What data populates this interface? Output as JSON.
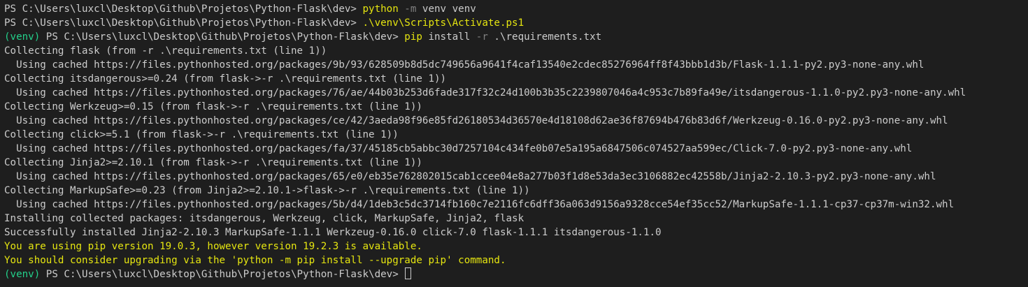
{
  "colors": {
    "background": "#1e1e1e",
    "default_text": "#cccccc",
    "command": "#e5e510",
    "parameter": "#808080",
    "venv": "#23d18b",
    "warning": "#e5e510"
  },
  "terminal": {
    "lines": [
      [
        {
          "text": "PS C:\\Users\\luxcl\\Desktop\\Github\\Projetos\\Python-Flask\\dev> ",
          "style": "default"
        },
        {
          "text": "python",
          "style": "yellow"
        },
        {
          "text": " -m",
          "style": "gray"
        },
        {
          "text": " venv venv",
          "style": "default"
        }
      ],
      [
        {
          "text": "PS C:\\Users\\luxcl\\Desktop\\Github\\Projetos\\Python-Flask\\dev> ",
          "style": "default"
        },
        {
          "text": ".\\venv\\Scripts\\Activate.ps1",
          "style": "yellow"
        }
      ],
      [
        {
          "text": "(venv)",
          "style": "venv"
        },
        {
          "text": " PS C:\\Users\\luxcl\\Desktop\\Github\\Projetos\\Python-Flask\\dev> ",
          "style": "default"
        },
        {
          "text": "pip",
          "style": "yellow"
        },
        {
          "text": " install",
          "style": "default"
        },
        {
          "text": " -r",
          "style": "gray"
        },
        {
          "text": " .\\requirements.txt",
          "style": "default"
        }
      ],
      [
        {
          "text": "Collecting flask (from -r .\\requirements.txt (line 1))",
          "style": "default"
        }
      ],
      [
        {
          "text": "  Using cached https://files.pythonhosted.org/packages/9b/93/628509b8d5dc749656a9641f4caf13540e2cdec85276964ff8f43bbb1d3b/Flask-1.1.1-py2.py3-none-any.whl",
          "style": "default"
        }
      ],
      [
        {
          "text": "Collecting itsdangerous>=0.24 (from flask->-r .\\requirements.txt (line 1))",
          "style": "default"
        }
      ],
      [
        {
          "text": "  Using cached https://files.pythonhosted.org/packages/76/ae/44b03b253d6fade317f32c24d100b3b35c2239807046a4c953c7b89fa49e/itsdangerous-1.1.0-py2.py3-none-any.whl",
          "style": "default"
        }
      ],
      [
        {
          "text": "Collecting Werkzeug>=0.15 (from flask->-r .\\requirements.txt (line 1))",
          "style": "default"
        }
      ],
      [
        {
          "text": "  Using cached https://files.pythonhosted.org/packages/ce/42/3aeda98f96e85fd26180534d36570e4d18108d62ae36f87694b476b83d6f/Werkzeug-0.16.0-py2.py3-none-any.whl",
          "style": "default"
        }
      ],
      [
        {
          "text": "Collecting click>=5.1 (from flask->-r .\\requirements.txt (line 1))",
          "style": "default"
        }
      ],
      [
        {
          "text": "  Using cached https://files.pythonhosted.org/packages/fa/37/45185cb5abbc30d7257104c434fe0b07e5a195a6847506c074527aa599ec/Click-7.0-py2.py3-none-any.whl",
          "style": "default"
        }
      ],
      [
        {
          "text": "Collecting Jinja2>=2.10.1 (from flask->-r .\\requirements.txt (line 1))",
          "style": "default"
        }
      ],
      [
        {
          "text": "  Using cached https://files.pythonhosted.org/packages/65/e0/eb35e762802015cab1ccee04e8a277b03f1d8e53da3ec3106882ec42558b/Jinja2-2.10.3-py2.py3-none-any.whl",
          "style": "default"
        }
      ],
      [
        {
          "text": "Collecting MarkupSafe>=0.23 (from Jinja2>=2.10.1->flask->-r .\\requirements.txt (line 1))",
          "style": "default"
        }
      ],
      [
        {
          "text": "  Using cached https://files.pythonhosted.org/packages/5b/d4/1deb3c5dc3714fb160c7e2116fc6dff36a063d9156a9328cce54ef35cc52/MarkupSafe-1.1.1-cp37-cp37m-win32.whl",
          "style": "default"
        }
      ],
      [
        {
          "text": "Installing collected packages: itsdangerous, Werkzeug, click, MarkupSafe, Jinja2, flask",
          "style": "default"
        }
      ],
      [
        {
          "text": "Successfully installed Jinja2-2.10.3 MarkupSafe-1.1.1 Werkzeug-0.16.0 click-7.0 flask-1.1.1 itsdangerous-1.1.0",
          "style": "default"
        }
      ],
      [
        {
          "text": "You are using pip version 19.0.3, however version 19.2.3 is available.",
          "style": "yellow"
        }
      ],
      [
        {
          "text": "You should consider upgrading via the 'python -m pip install --upgrade pip' command.",
          "style": "yellow"
        }
      ],
      [
        {
          "text": "(venv)",
          "style": "venv"
        },
        {
          "text": " PS C:\\Users\\luxcl\\Desktop\\Github\\Projetos\\Python-Flask\\dev> ",
          "style": "default"
        }
      ]
    ]
  }
}
